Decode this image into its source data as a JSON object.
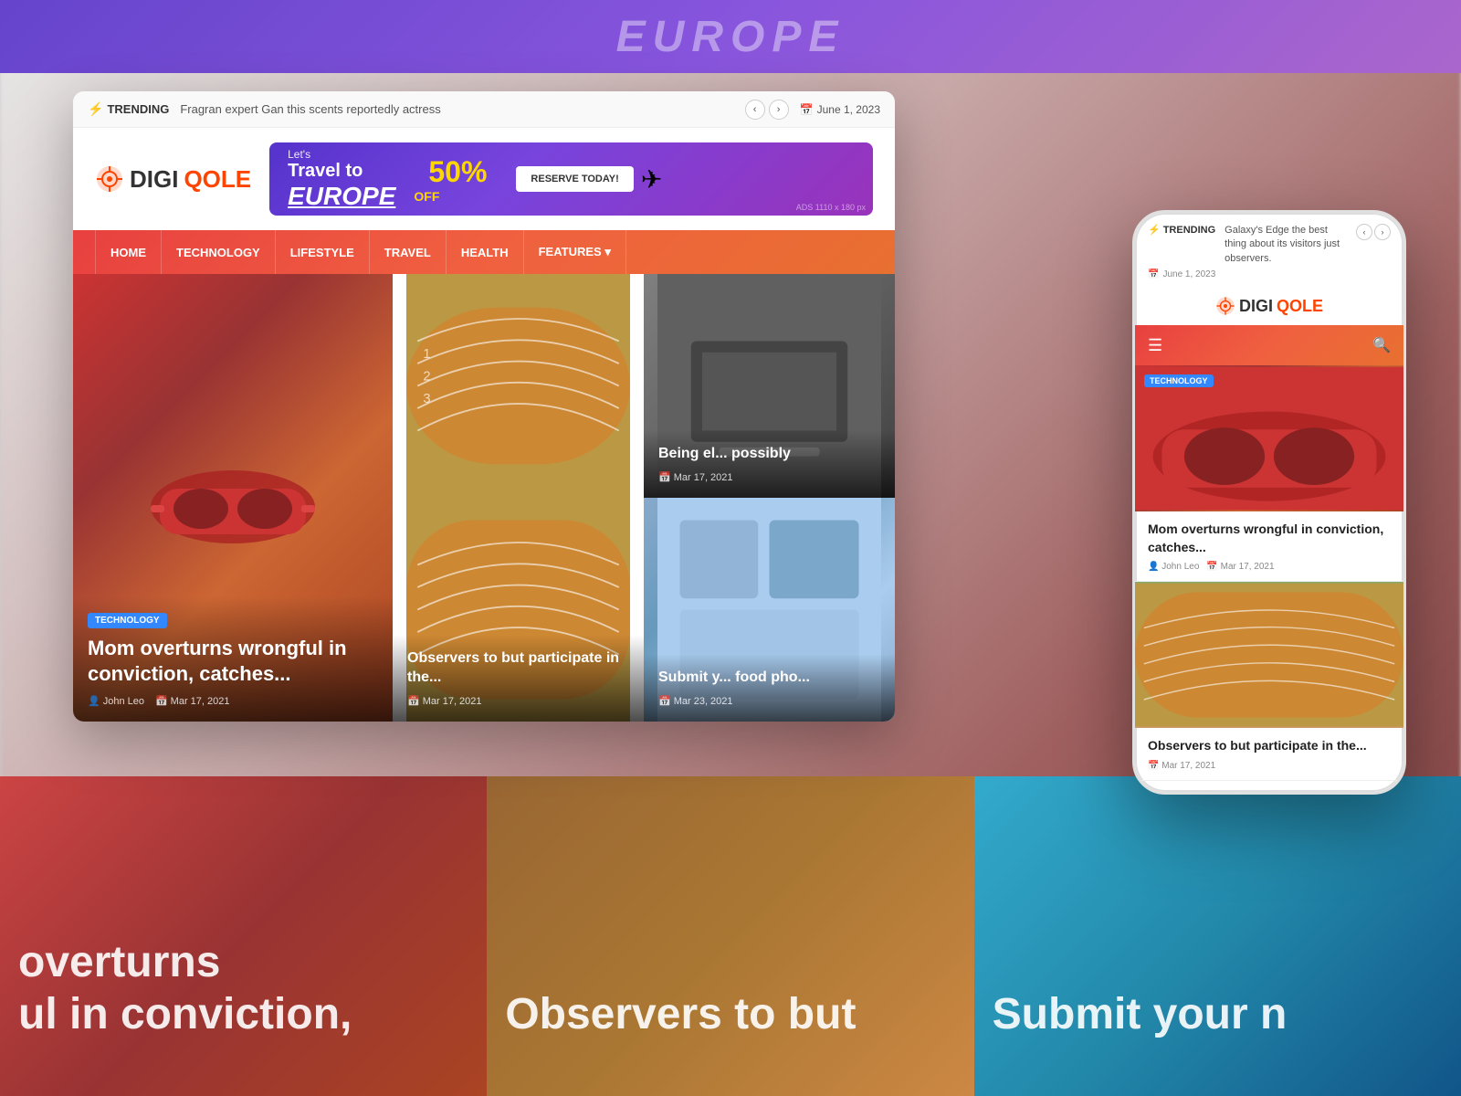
{
  "site": {
    "name_digi": "DIGI",
    "name_qole": "QOLE",
    "logo_icon": "⚙"
  },
  "trending": {
    "label": "TRENDING",
    "text": "Fragran expert Gan this scents reportedly actress",
    "date": "June 1, 2023",
    "bolt_icon": "⚡"
  },
  "ad_banner": {
    "lets": "Let's",
    "travel": "Travel to",
    "europe": "EUROPE",
    "percent": "50%",
    "off": "OFF",
    "reserve_btn": "RESERVE TODAY!",
    "tag": "ADS 1110 x 180 px",
    "plane_icon": "✈"
  },
  "nav": {
    "items": [
      {
        "label": "HOME"
      },
      {
        "label": "TECHNOLOGY"
      },
      {
        "label": "LIFESTYLE"
      },
      {
        "label": "TRAVEL"
      },
      {
        "label": "HEALTH"
      },
      {
        "label": "FEATURES ▾"
      }
    ]
  },
  "articles": {
    "main": {
      "tag": "TECHNOLOGY",
      "title": "Mom overturns wrongful in conviction, catches...",
      "author": "John Leo",
      "date": "Mar 17, 2021"
    },
    "top_right": {
      "title": "Being el... possibly",
      "date": "Mar 17, 2021"
    },
    "middle_right": {
      "title": "Submit y... food pho...",
      "date": "Mar 23, 2021"
    },
    "center": {
      "title": "Observers to but participate in the...",
      "date": "Mar 17, 2021"
    }
  },
  "mobile": {
    "trending": {
      "label": "TRENDING",
      "text": "Galaxy's Edge the best thing about its visitors just observers.",
      "date": "June 1, 2023"
    },
    "article1": {
      "tag": "TECHNOLOGY",
      "title": "Mom overturns wrongful in conviction, catches...",
      "author": "John Leo",
      "date": "Mar 17, 2021"
    },
    "article2": {
      "title": "Observers to but participate in the...",
      "date": "Mar 17, 2021"
    }
  },
  "bottom_texts": {
    "col1_line1": "overturns",
    "col1_line2": "ul in conviction,",
    "col2": "Observers to but",
    "col3": "Submit your n"
  },
  "colors": {
    "brand_red": "#e84040",
    "brand_orange": "#f06040",
    "nav_gradient_start": "#e84040",
    "nav_gradient_end": "#e87030",
    "tag_blue": "#3388ff",
    "gold": "#ffd700"
  }
}
